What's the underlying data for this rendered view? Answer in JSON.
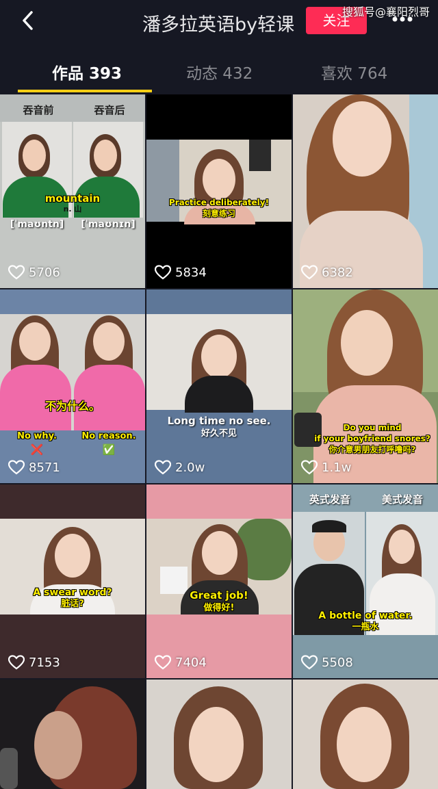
{
  "header": {
    "title": "潘多拉英语by轻课",
    "follow_label": "关注",
    "watermark": "搜狐号@襄阳烈哥",
    "back_icon": "chevron-left-icon",
    "more_icon": "more-dots-icon"
  },
  "tabs": [
    {
      "label": "作品 393",
      "active": true
    },
    {
      "label": "动态 432",
      "active": false
    },
    {
      "label": "喜欢 764",
      "active": false
    }
  ],
  "colors": {
    "accent": "#fe2c55",
    "underline": "#face15",
    "bg": "#161823"
  },
  "videos": [
    {
      "likes": "5706",
      "captions": [
        "吞音前",
        "吞音后",
        "mountain",
        "n. 山",
        "[ˈmaʊntn]",
        "[ˈmaʊnɪn]"
      ]
    },
    {
      "likes": "5834",
      "captions": [
        "Practice deliberately!",
        "刻意练习"
      ]
    },
    {
      "likes": "6382",
      "captions": []
    },
    {
      "likes": "8571",
      "captions": [
        "不为什么。",
        "No why.",
        "No reason.",
        "❌",
        "✅"
      ]
    },
    {
      "likes": "2.0w",
      "captions": [
        "Long time no see.",
        "好久不见"
      ]
    },
    {
      "likes": "1.1w",
      "captions": [
        "Do you mind",
        "if your boyfriend snores?",
        "你介意男朋友打呼噜吗?"
      ]
    },
    {
      "likes": "7153",
      "captions": [
        "A swear word?",
        "脏话?"
      ]
    },
    {
      "likes": "7404",
      "captions": [
        "Great job!",
        "做得好!"
      ]
    },
    {
      "likes": "5508",
      "captions": [
        "英式发音",
        "美式发音",
        "A bottle of water.",
        "一瓶水"
      ]
    },
    {
      "likes": "",
      "captions": []
    },
    {
      "likes": "",
      "captions": []
    },
    {
      "likes": "",
      "captions": []
    }
  ]
}
